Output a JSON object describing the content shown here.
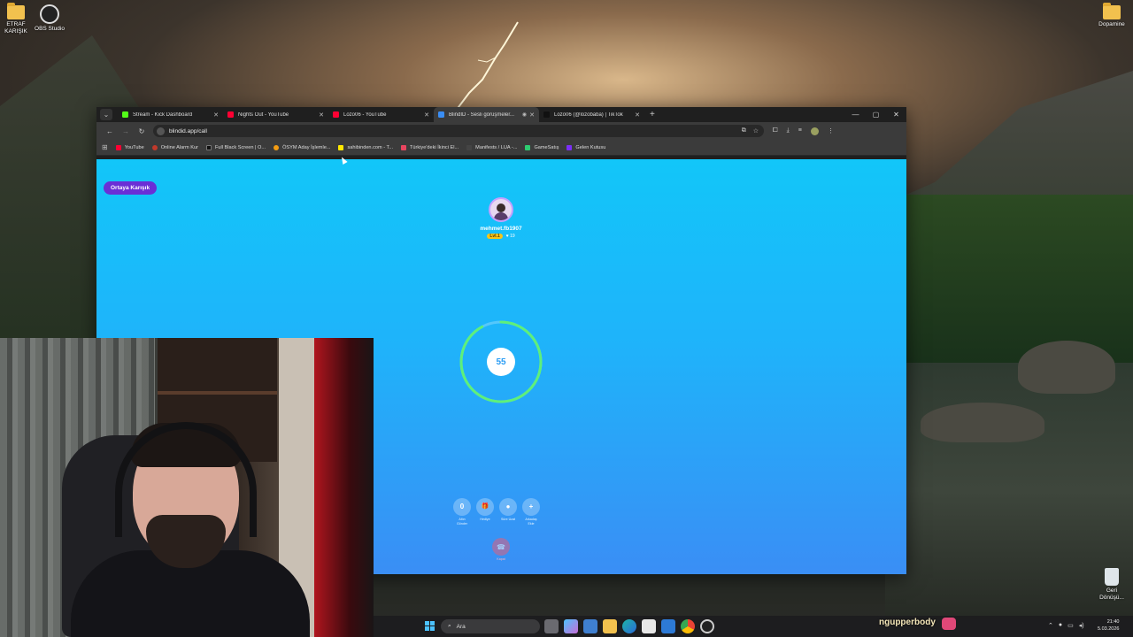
{
  "desktop": {
    "icons": [
      {
        "label_line1": "ETRAF",
        "label_line2": "KARIŞIK",
        "icon": "folder-icon"
      },
      {
        "label_line1": "OBS Studio",
        "label_line2": "",
        "icon": "obs-icon"
      },
      {
        "label_line1": "Dopamine",
        "label_line2": "",
        "icon": "folder-icon"
      },
      {
        "label_line1": "Geri",
        "label_line2": "Dönüşü...",
        "icon": "recycle-bin-icon"
      }
    ]
  },
  "browser": {
    "tabs": [
      {
        "title": "Stream - Kick Dashboard",
        "favicon_color": "#53fc18",
        "active": false
      },
      {
        "title": "Nights Out - YouTube",
        "favicon_color": "#ff0033",
        "active": false
      },
      {
        "title": "Lozo06 - YouTube",
        "favicon_color": "#ff0033",
        "active": false
      },
      {
        "title": "BlindID - Sesli görüşmeler...",
        "favicon_color": "#3a8ef5",
        "active": true
      },
      {
        "title": "Lozo06 (@lozobaba) | TikTok",
        "favicon_color": "#111111",
        "active": false
      }
    ],
    "url": "blindid.app/call",
    "bookmarks": [
      {
        "label": "YouTube",
        "color": "#ff0033"
      },
      {
        "label": "Online Alarm Kur",
        "color": "#c0392b"
      },
      {
        "label": "Full Black Screen | O...",
        "color": "#111111"
      },
      {
        "label": "ÖSYM Aday İşlemle...",
        "color": "#f39c12"
      },
      {
        "label": "sahibinden.com - T...",
        "color": "#ffe800"
      },
      {
        "label": "Türkiye'deki İkinci El...",
        "color": "#e8455f"
      },
      {
        "label": "Manifests / LUA -...",
        "color": "#444444"
      },
      {
        "label": "GameSatış",
        "color": "#2ecc71"
      },
      {
        "label": "Gelen Kutusu",
        "color": "#7b2ff7"
      }
    ]
  },
  "page": {
    "mode_label": "Ortaya Karışık",
    "user": {
      "name": "mehmet.fb1907",
      "level": "Lvl.1",
      "likes": "♥ 19"
    },
    "countdown": "55",
    "countdown_progress": 0.92,
    "actions": [
      {
        "symbol": "0",
        "label_line1": "Altın",
        "label_line2": "Gönder"
      },
      {
        "symbol": "🎁",
        "label_line1": "Hediye",
        "label_line2": ""
      },
      {
        "symbol": "●",
        "label_line1": "Süre Uzat",
        "label_line2": ""
      },
      {
        "symbol": "+",
        "label_line1": "Arkadaş",
        "label_line2": "Ekle"
      }
    ],
    "hangup_label": "Kapat"
  },
  "taskbar": {
    "search_placeholder": "Ara",
    "streamer_name": "ngupperbody",
    "time": "21:40",
    "date": "5.03.2026"
  },
  "colors": {
    "page_top": "#12c6f9",
    "page_bottom": "#3a8ef5",
    "accent_purple": "#6a2fd6",
    "ring_green": "#5ef07a"
  }
}
